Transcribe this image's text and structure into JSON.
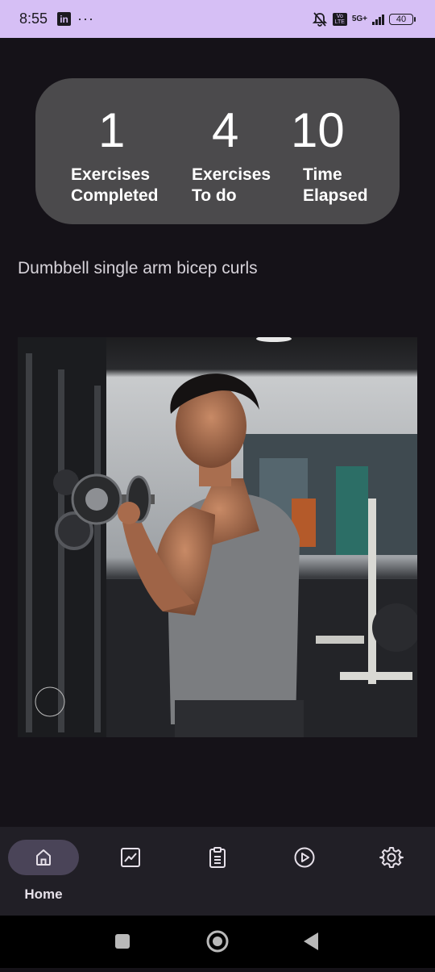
{
  "status_bar": {
    "time": "8:55",
    "app_icon": "in",
    "more": "···",
    "volte": "Vo LTE",
    "network": "5G+",
    "battery": "40",
    "icons": [
      "linkedin-icon",
      "dnd-bell-off-icon",
      "volte-icon",
      "signal-icon",
      "battery-icon"
    ]
  },
  "stats": {
    "completed": {
      "value": "1",
      "label_line1": "Exercises",
      "label_line2": "Completed"
    },
    "todo": {
      "value": "4",
      "label_line1": "Exercises",
      "label_line2": "To do"
    },
    "elapsed": {
      "value": "10",
      "label_line1": "Time",
      "label_line2": "Elapsed"
    }
  },
  "exercise": {
    "name": "Dumbbell single arm bicep curls",
    "image_subject": "man doing dumbbell bicep curl in gym"
  },
  "nav": {
    "items": [
      {
        "label": "Home",
        "icon": "home-icon",
        "active": true
      },
      {
        "label": "",
        "icon": "chart-icon",
        "active": false
      },
      {
        "label": "",
        "icon": "clipboard-icon",
        "active": false
      },
      {
        "label": "",
        "icon": "play-icon",
        "active": false
      },
      {
        "label": "",
        "icon": "gear-icon",
        "active": false
      }
    ]
  },
  "system_nav": {
    "icons": [
      "recents-icon",
      "home-circle-icon",
      "back-icon"
    ]
  },
  "colors": {
    "status_bar_bg": "#d6bff5",
    "background": "#151218",
    "card": "#4b4a4c",
    "nav_bg": "#211f26",
    "nav_active_pill": "#4a4458"
  }
}
